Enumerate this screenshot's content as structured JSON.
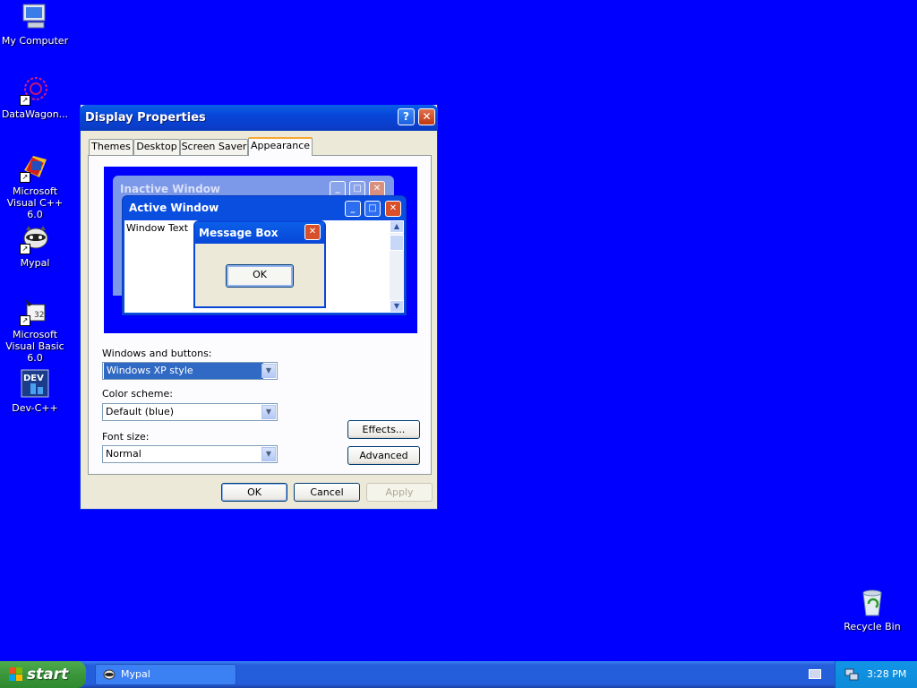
{
  "desktop": {
    "icons": [
      {
        "label": "My Computer",
        "icon": "my-computer-icon"
      },
      {
        "label": "DataWagon...",
        "icon": "datawagon-icon"
      },
      {
        "label": "Microsoft Visual C++ 6.0",
        "icon": "visual-cpp-icon"
      },
      {
        "label": "Mypal",
        "icon": "mypal-icon"
      },
      {
        "label": "Microsoft Visual Basic 6.0",
        "icon": "visual-basic-icon"
      },
      {
        "label": "Dev-C++",
        "icon": "dev-cpp-icon"
      },
      {
        "label": "Recycle Bin",
        "icon": "recycle-bin-icon"
      }
    ],
    "background_color": "#0000ff"
  },
  "dialog": {
    "title": "Display Properties",
    "help_button": "?",
    "tabs": [
      "Themes",
      "Desktop",
      "Screen Saver",
      "Appearance"
    ],
    "selected_tab": "Appearance",
    "preview": {
      "inactive_title": "Inactive Window",
      "active_title": "Active Window",
      "window_text": "Window Text",
      "message_box_title": "Message Box",
      "message_box_ok": "OK"
    },
    "windows_and_buttons": {
      "label": "Windows and buttons:",
      "value": "Windows XP style"
    },
    "color_scheme": {
      "label": "Color scheme:",
      "value": "Default (blue)"
    },
    "font_size": {
      "label": "Font size:",
      "value": "Normal"
    },
    "effects_button": "Effects...",
    "advanced_button": "Advanced",
    "ok_button": "OK",
    "cancel_button": "Cancel",
    "apply_button": "Apply"
  },
  "taskbar": {
    "start_label": "start",
    "task_item": "Mypal",
    "clock": "3:28 PM"
  }
}
